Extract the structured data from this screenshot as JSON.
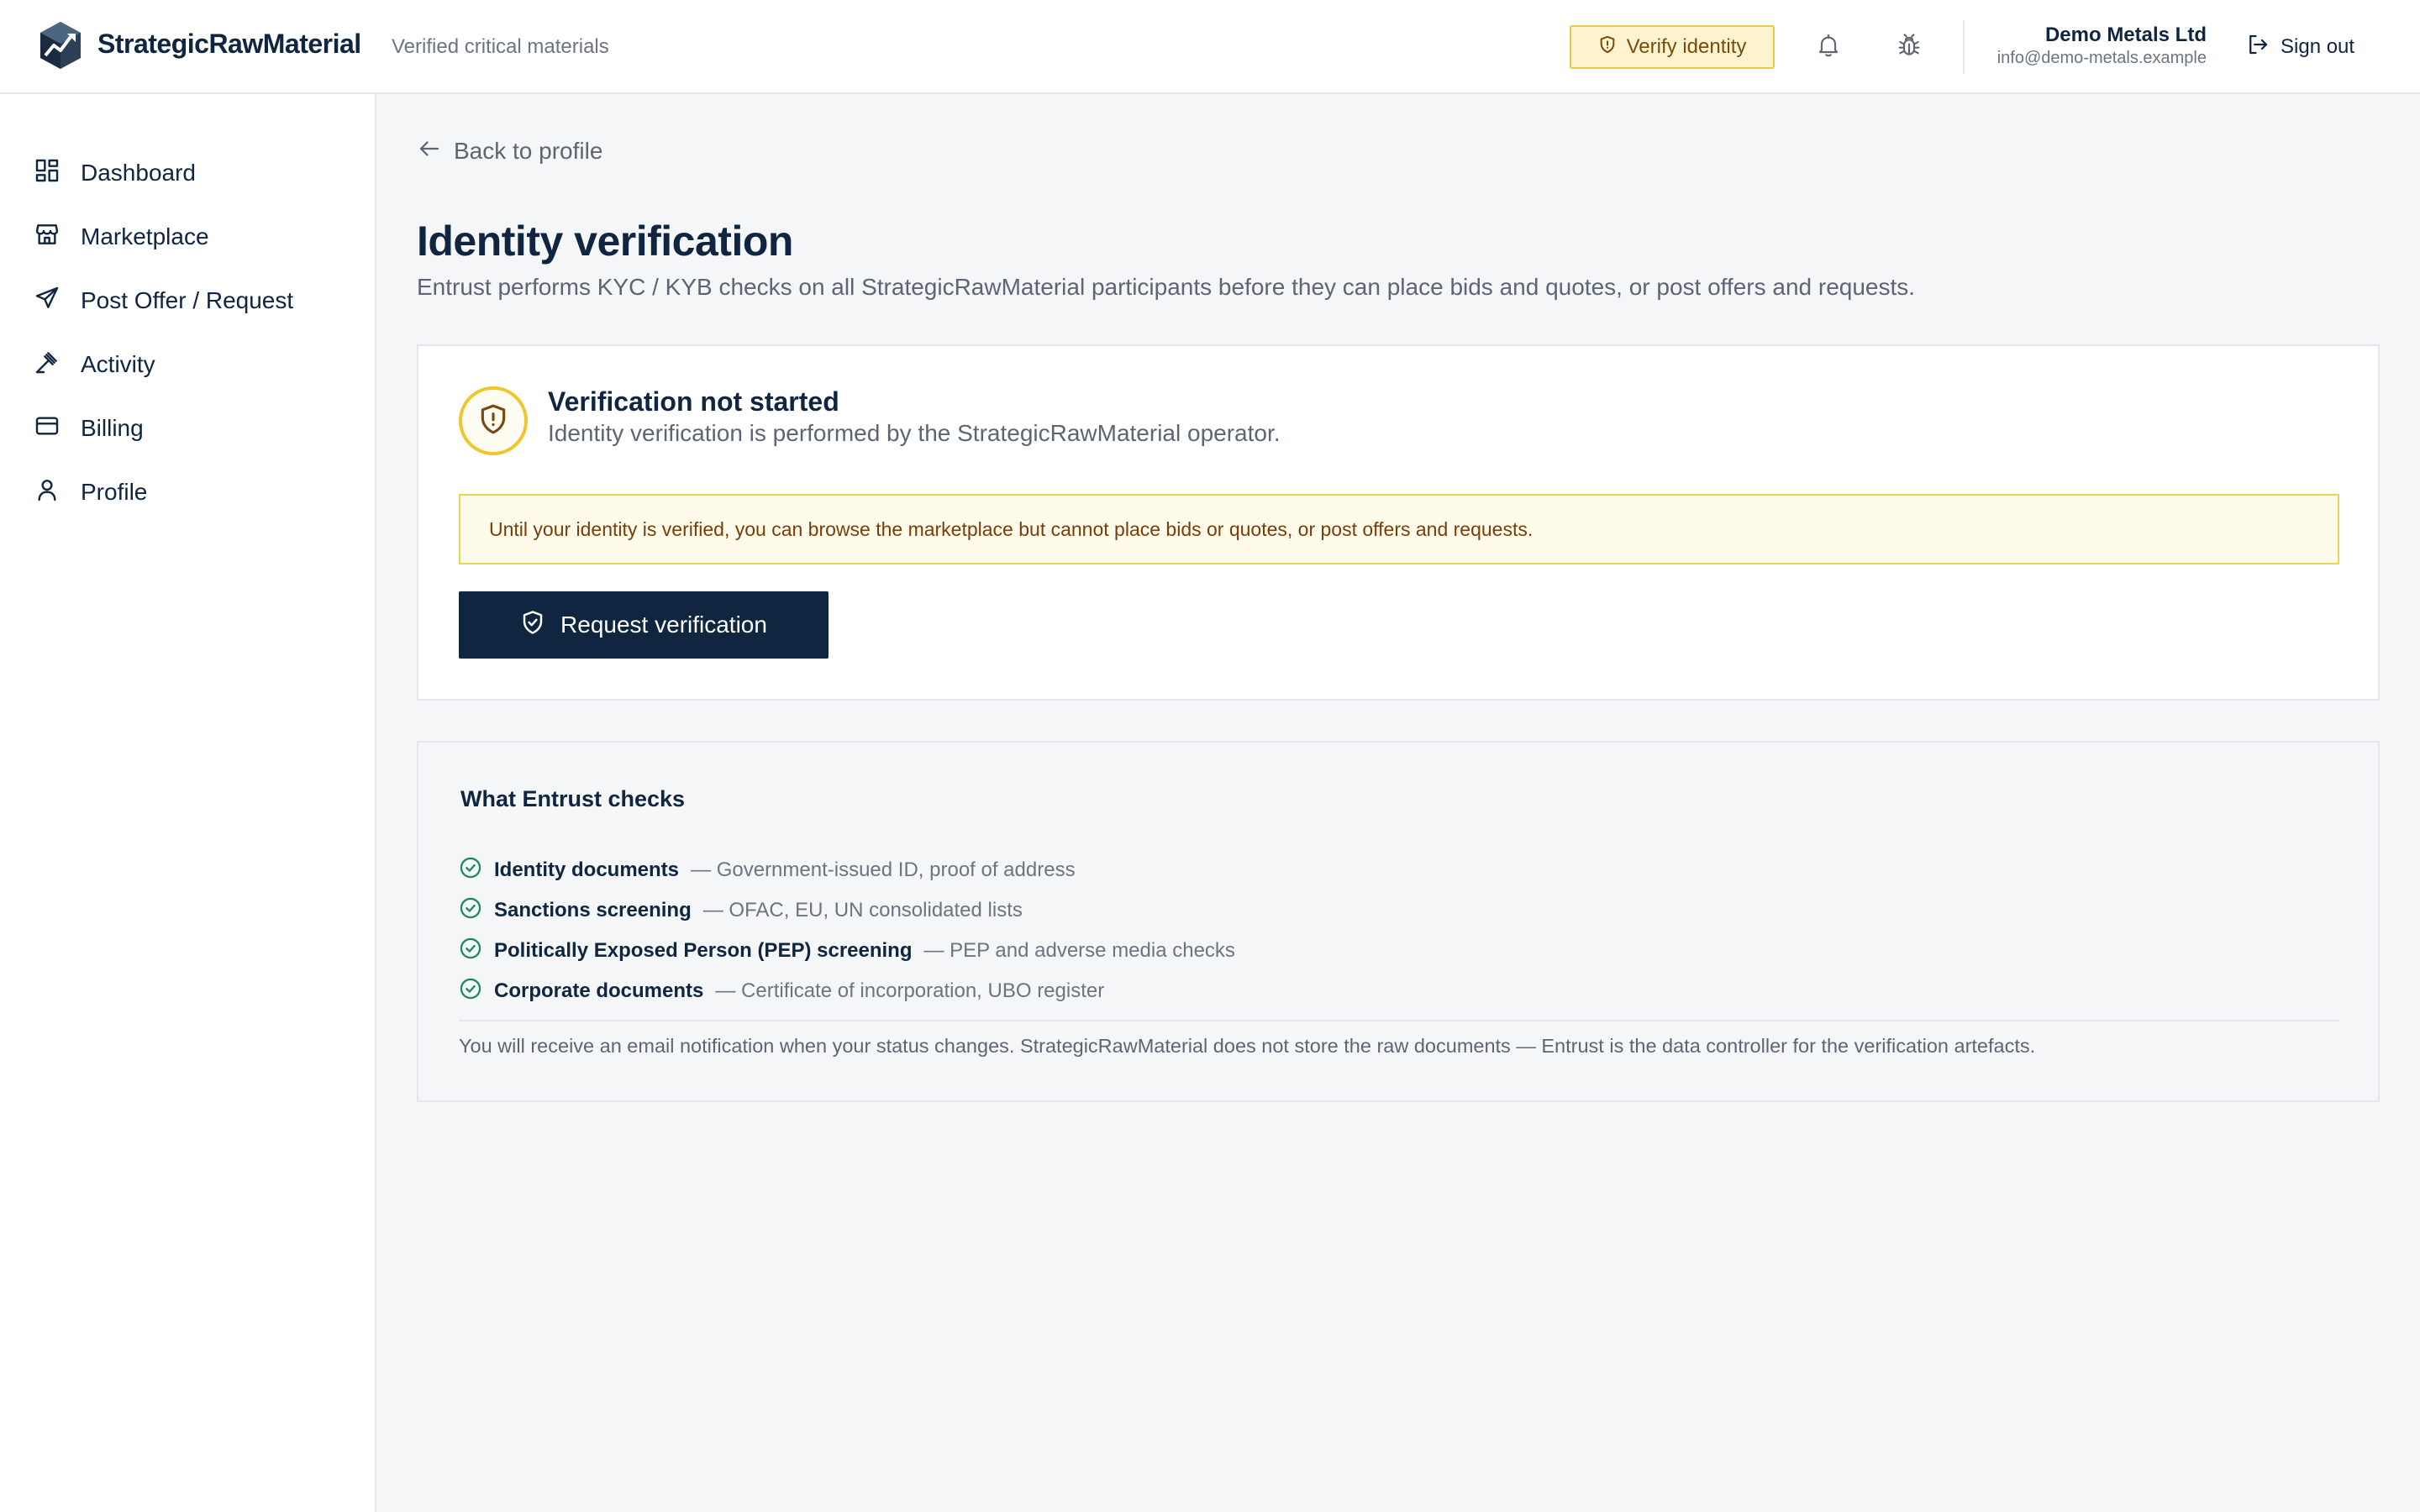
{
  "header": {
    "brand_name": "StrategicRawMaterial",
    "tagline": "Verified critical materials",
    "verify_label": "Verify identity",
    "user_name": "Demo Metals Ltd",
    "user_email": "info@demo-metals.example",
    "signout_label": "Sign out",
    "icons": [
      "logo-icon",
      "shield-alert-icon",
      "bell-icon",
      "bug-icon",
      "sign-out-icon"
    ]
  },
  "sidebar": {
    "items": [
      {
        "label": "Dashboard",
        "icon": "dashboard-icon"
      },
      {
        "label": "Marketplace",
        "icon": "store-icon"
      },
      {
        "label": "Post Offer / Request",
        "icon": "send-icon"
      },
      {
        "label": "Activity",
        "icon": "gavel-icon"
      },
      {
        "label": "Billing",
        "icon": "credit-card-icon"
      },
      {
        "label": "Profile",
        "icon": "user-icon"
      }
    ]
  },
  "main": {
    "back_label": "Back to profile",
    "title": "Identity verification",
    "subtitle": "Entrust performs KYC / KYB checks on all StrategicRawMaterial participants before they can place bids and quotes, or post offers and requests.",
    "status": {
      "title": "Verification not started",
      "description": "Identity verification is performed by the StrategicRawMaterial operator.",
      "notice": "Until your identity is verified, you can browse the marketplace but cannot place bids or quotes, or post offers and requests.",
      "button_label": "Request verification"
    },
    "checks": {
      "title": "What Entrust checks",
      "items": [
        {
          "name": "Identity documents",
          "desc": "— Government-issued ID, proof of address"
        },
        {
          "name": "Sanctions screening",
          "desc": "— OFAC, EU, UN consolidated lists"
        },
        {
          "name": "Politically Exposed Person (PEP) screening",
          "desc": "— PEP and adverse media checks"
        },
        {
          "name": "Corporate documents",
          "desc": "— Certificate of incorporation, UBO register"
        }
      ],
      "note": "You will receive an email notification when your status changes. StrategicRawMaterial does not store the raw documents — Entrust is the data controller for the verification artefacts."
    }
  },
  "colors": {
    "navy": "#0f2540",
    "warning_border": "#ecd45a",
    "warning_bg": "#fffbea",
    "warning_text": "#7a3d07",
    "check_green": "#1f8a5a"
  }
}
